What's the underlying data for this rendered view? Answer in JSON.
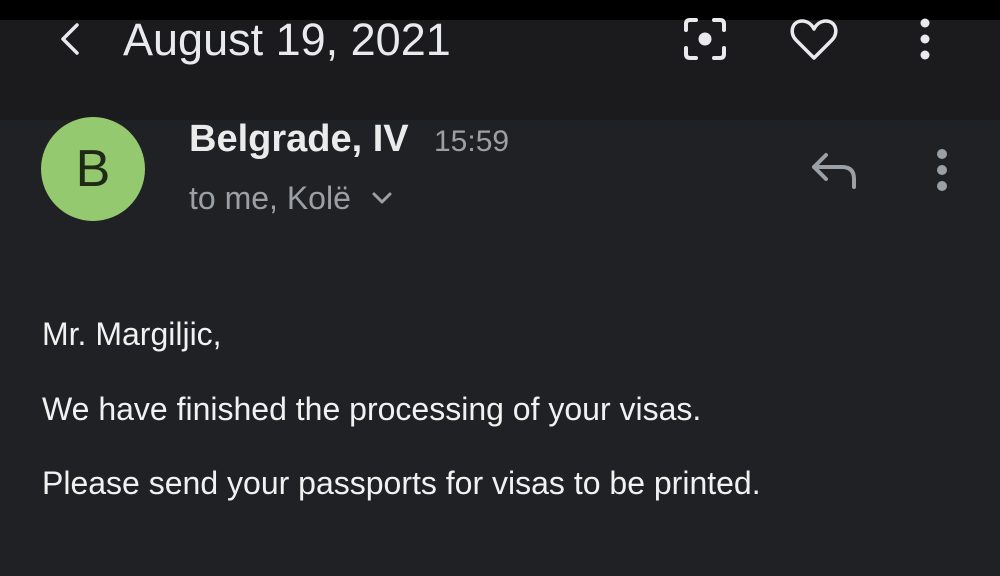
{
  "header": {
    "title": "August 19, 2021",
    "icons": [
      "back-icon",
      "scan-icon",
      "heart-icon",
      "more-vertical-icon"
    ]
  },
  "message": {
    "avatar_letter": "B",
    "avatar_color": "#94c96f",
    "sender": "Belgrade, IV",
    "time": "15:59",
    "recipients": "to me, Kolë",
    "icons": [
      "reply-icon",
      "more-vertical-icon",
      "chevron-down-icon"
    ]
  },
  "body": {
    "greeting": "Mr. Margiljic,",
    "line1": "We have finished the processing of your visas.",
    "line2": "Please send your passports for visas to be printed."
  },
  "colors": {
    "background": "#202124",
    "topbar": "#1b1b1d",
    "secondary_text": "#9aa0a6"
  }
}
